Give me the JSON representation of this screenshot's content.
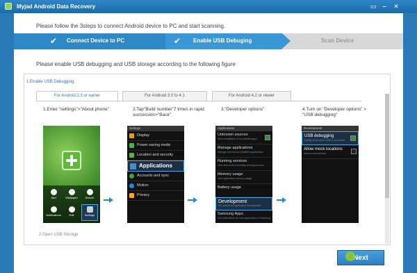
{
  "window": {
    "title": "Myjad Android Data Recovery",
    "controls": [
      "▭",
      "–",
      "✕"
    ]
  },
  "intro_text": "Please follow the 3steps to connect Android device to PC and start scanning.",
  "steps": [
    {
      "label": "Connect Device to PC",
      "state": "done"
    },
    {
      "label": "Enable USB Debuging",
      "state": "current"
    },
    {
      "label": "Scan Device",
      "state": "pending"
    }
  ],
  "sub_instruction": "Please enable USB debugging and USB storage according to the following figure",
  "section1_title": "1.Enable USB Debugging",
  "tabs": [
    {
      "label": "For Android 2.3 or earlier",
      "active": true
    },
    {
      "label": "For Android 3.0 to 4.1",
      "active": false
    },
    {
      "label": "For Android 4.2 or newer",
      "active": false
    }
  ],
  "instructions": [
    "1.Enter \"settings\">\"About phone\"",
    "2.Tap\"Build number\"7 times in rapid succession>\"Back\"",
    "3.\"Developer options\"",
    "4.Turn on \"Developer options\" > \"USB debugging\""
  ],
  "phone1": {
    "dock": [
      "Add",
      "Wallpaper",
      "Search",
      "Notifications",
      "Edit",
      "Settings"
    ]
  },
  "phone2": {
    "header": "Settings",
    "items": [
      {
        "label": "Display",
        "icon": "display-icon",
        "color": "#e0a020"
      },
      {
        "label": "Power saving mode",
        "icon": "battery-icon",
        "color": "#4caf50"
      },
      {
        "label": "Location and security",
        "icon": "lock-icon",
        "color": "#6aa84f"
      },
      {
        "label": "Applications",
        "icon": "grid-icon",
        "color": "#3a8fd6"
      },
      {
        "label": "Accounts and sync",
        "icon": "sync-icon",
        "color": "#43a047"
      },
      {
        "label": "Motion",
        "icon": "motion-icon",
        "color": "#1e88e5"
      },
      {
        "label": "Privacy",
        "icon": "privacy-icon",
        "color": "#f9a825"
      }
    ]
  },
  "phone3": {
    "header": "Applications",
    "items": [
      {
        "title": "Unknown sources",
        "sub": "Allow installation of non-Market apps",
        "checkbox": true
      },
      {
        "title": "Manage applications",
        "sub": "Manage and remove installed applications",
        "checkbox": false
      },
      {
        "title": "Running services",
        "sub": "View and control currently running services",
        "checkbox": false
      },
      {
        "title": "Memory usage",
        "sub": "View application memory usage",
        "checkbox": false
      },
      {
        "title": "Battery usage",
        "sub": "",
        "checkbox": false
      },
      {
        "title": "Development",
        "sub": "Set options for application development",
        "checkbox": false
      },
      {
        "title": "Samsung Apps",
        "sub": "Get notifications for new applications in Samsung Apps",
        "checkbox": false
      }
    ]
  },
  "phone4": {
    "header": "Development",
    "items": [
      {
        "title": "USB debugging",
        "sub": "Debug mode when USB is connected",
        "checked": true
      },
      {
        "title": "Allow mock locations",
        "sub": "Allow mock locations",
        "checked": false
      }
    ]
  },
  "section2_title": "2.Open USB Storage",
  "next_label": "Next",
  "colors": {
    "accent": "#2e88c7",
    "title_bar": "#1d6aa8",
    "highlight": "#4aa9e6"
  }
}
